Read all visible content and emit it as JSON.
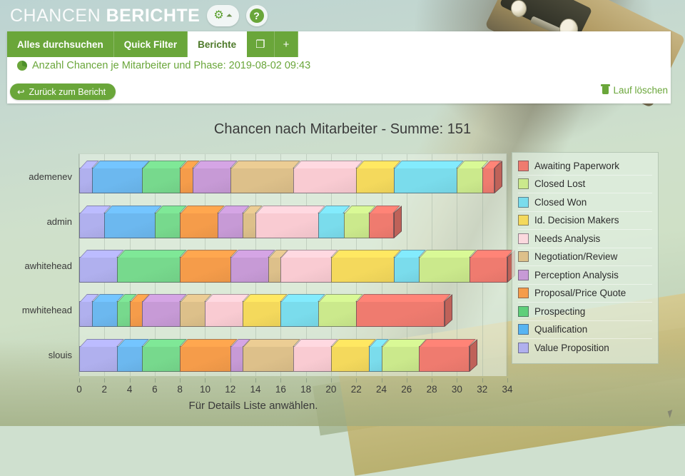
{
  "titlebar": {
    "title_thin": "CHANCEN",
    "title_bold": "BERICHTE",
    "gear_icon": "gear-icon",
    "chevron_icon": "chevron-down-icon",
    "help_icon": "help-icon",
    "help_label": "?"
  },
  "tabs": [
    {
      "label": "Alles durchsuchen",
      "active": false
    },
    {
      "label": "Quick Filter",
      "active": false
    },
    {
      "label": "Berichte",
      "active": true
    },
    {
      "label": "❐",
      "active": false,
      "icon": "duplicate-icon"
    },
    {
      "label": "+",
      "active": false,
      "icon": "plus-icon"
    }
  ],
  "report": {
    "icon": "pie-chart-icon",
    "line": "Anzahl Chancen je Mitarbeiter und Phase: 2019-08-02 09:43",
    "back_button": "Zurück zum Bericht",
    "back_icon": "back-arrow-icon",
    "delete_label": "Lauf löschen",
    "delete_icon": "trash-icon"
  },
  "chart_data": {
    "type": "bar",
    "orientation": "horizontal",
    "stacked": true,
    "title": "Chancen nach Mitarbeiter - Summe: 151",
    "xlabel": "",
    "ylabel": "",
    "note": "Für Details Liste anwählen.",
    "xlim": [
      0,
      34
    ],
    "xticks": [
      0,
      2,
      4,
      6,
      8,
      10,
      12,
      14,
      16,
      18,
      20,
      22,
      24,
      26,
      28,
      30,
      32,
      34
    ],
    "grid": true,
    "legend_position": "right",
    "categories": [
      "ademenev",
      "admin",
      "awhitehead",
      "mwhitehead",
      "slouis"
    ],
    "series": [
      {
        "name": "Value Proposition",
        "color": "#b0b0ee",
        "values": [
          1,
          2,
          3,
          1,
          3
        ]
      },
      {
        "name": "Qualification",
        "color": "#6cb8ef",
        "values": [
          4,
          4,
          0,
          2,
          2
        ]
      },
      {
        "name": "Prospecting",
        "color": "#77d98d",
        "values": [
          3,
          2,
          5,
          1,
          3
        ]
      },
      {
        "name": "Proposal/Price Quote",
        "color": "#f5a köpfe",
        "values": [
          1,
          3,
          4,
          1,
          4
        ]
      },
      {
        "name": "Perception Analysis",
        "color": "#c79ad6",
        "values": [
          3,
          2,
          3,
          3,
          1
        ]
      },
      {
        "name": "Negotiation/Review",
        "color": "#ddc08a",
        "values": [
          5,
          1,
          1,
          2,
          4
        ]
      },
      {
        "name": "Needs Analysis",
        "color": "#f9cbd2",
        "values": [
          5,
          5,
          4,
          3,
          3
        ]
      },
      {
        "name": "Id. Decision Makers",
        "color": "#f4d95c",
        "values": [
          3,
          0,
          5,
          3,
          3
        ]
      },
      {
        "name": "Closed Won",
        "color": "#7adcec",
        "values": [
          5,
          2,
          2,
          3,
          1
        ]
      },
      {
        "name": "Closed Lost",
        "color": "#cbe98c",
        "values": [
          2,
          2,
          4,
          3,
          3
        ]
      },
      {
        "name": "Awaiting Paperwork",
        "color": "#ef7b6f",
        "values": [
          1,
          2,
          3,
          7,
          4
        ]
      }
    ],
    "totals": [
      33,
      25,
      34,
      29,
      31
    ],
    "grand_total": 151
  },
  "legend": [
    {
      "label": "Awaiting Paperwork",
      "color": "#ef7b6f"
    },
    {
      "label": "Closed Lost",
      "color": "#cbe98c"
    },
    {
      "label": "Closed Won",
      "color": "#7adcec"
    },
    {
      "label": "Id. Decision Makers",
      "color": "#f4d95c"
    },
    {
      "label": "Needs Analysis",
      "color": "#fbd9de"
    },
    {
      "label": "Negotiation/Review",
      "color": "#ddc08a"
    },
    {
      "label": "Perception Analysis",
      "color": "#c79ad6"
    },
    {
      "label": "Proposal/Price Quote",
      "color": "#f59c4a"
    },
    {
      "label": "Prospecting",
      "color": "#5fcf7a"
    },
    {
      "label": "Qualification",
      "color": "#57b4f2"
    },
    {
      "label": "Value Proposition",
      "color": "#b0b0ee"
    }
  ],
  "colors": {
    "brand_green": "#6aa63a",
    "tab_text": "#ffffff"
  }
}
